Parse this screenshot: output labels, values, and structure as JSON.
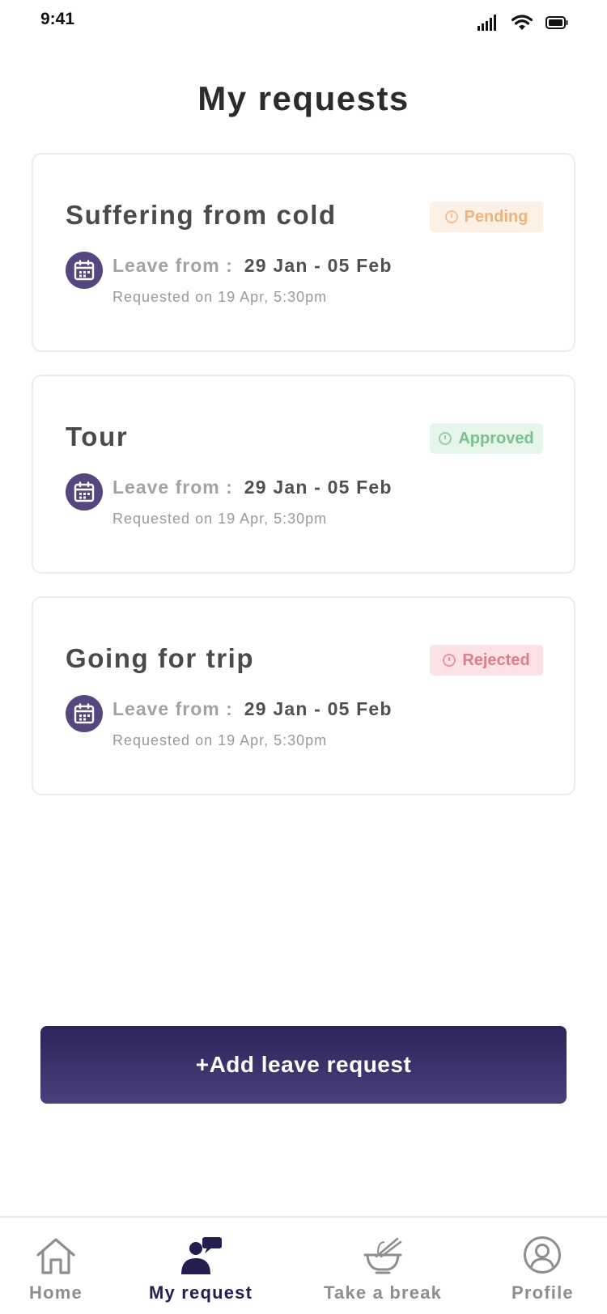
{
  "status_bar": {
    "time": "9:41"
  },
  "header": {
    "title": "My requests"
  },
  "requests": [
    {
      "title": "Suffering from cold",
      "status": "Pending",
      "leave_label": "Leave from :",
      "dates": "29 Jan - 05 Feb",
      "requested": "Requested on 19 Apr, 5:30pm"
    },
    {
      "title": "Tour",
      "status": "Approved",
      "leave_label": "Leave from :",
      "dates": "29 Jan - 05 Feb",
      "requested": "Requested on 19 Apr, 5:30pm"
    },
    {
      "title": "Going for trip",
      "status": "Rejected",
      "leave_label": "Leave from :",
      "dates": "29 Jan - 05 Feb",
      "requested": "Requested on 19 Apr, 5:30pm"
    }
  ],
  "actions": {
    "add_label": "+Add leave request"
  },
  "tab_bar": {
    "tabs": [
      {
        "label": "Home",
        "icon": "home-icon"
      },
      {
        "label": "My request",
        "icon": "person-chat-icon",
        "active": true
      },
      {
        "label": "Take a break",
        "icon": "noodle-bowl-icon"
      },
      {
        "label": "Profile",
        "icon": "profile-icon"
      }
    ]
  },
  "colors": {
    "primary": "#2c2459",
    "pending_text": "#f0b27e",
    "pending_bg": "#fdf1e6",
    "approved_text": "#7cc18d",
    "approved_bg": "#e6f5ea",
    "rejected_text": "#e07d86",
    "rejected_bg": "#fbe2e4"
  }
}
